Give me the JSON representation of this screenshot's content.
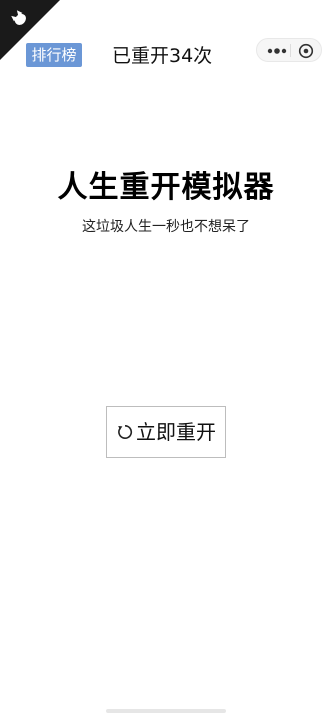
{
  "header": {
    "rank_label": "排行榜",
    "restart_count_text": "已重开34次"
  },
  "main": {
    "title": "人生重开模拟器",
    "subtitle": "这垃圾人生一秒也不想呆了",
    "restart_button_label": "立即重开"
  },
  "icons": {
    "corner": "cat-ribbon-icon",
    "menu": "more-dots-icon",
    "close": "target-close-icon",
    "restart": "refresh-icon"
  },
  "colors": {
    "rank_bg": "#6b97d6",
    "text": "#111111",
    "background": "#ffffff"
  }
}
